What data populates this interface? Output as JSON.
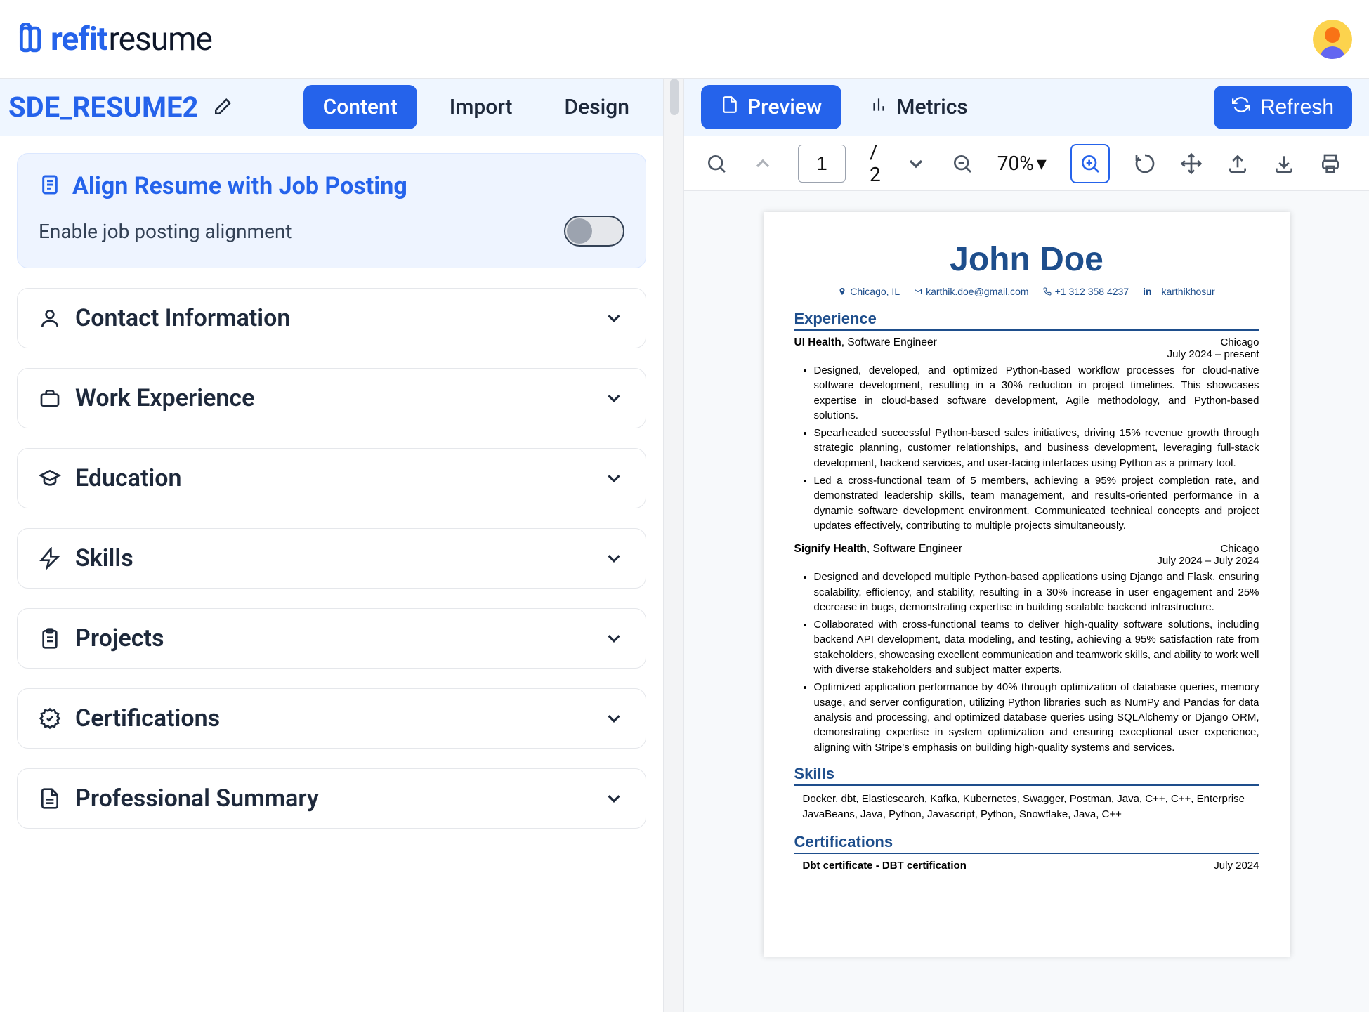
{
  "header": {
    "logo_refit": "refit",
    "logo_resume": "resume"
  },
  "left": {
    "resume_name": "SDE_RESUME2",
    "tabs": {
      "content": "Content",
      "import": "Import",
      "design": "Design"
    },
    "align": {
      "title": "Align Resume with Job Posting",
      "enable_label": "Enable job posting alignment"
    },
    "sections": [
      {
        "id": "contact",
        "label": "Contact Information"
      },
      {
        "id": "work",
        "label": "Work Experience"
      },
      {
        "id": "education",
        "label": "Education"
      },
      {
        "id": "skills",
        "label": "Skills"
      },
      {
        "id": "projects",
        "label": "Projects"
      },
      {
        "id": "certs",
        "label": "Certifications"
      },
      {
        "id": "summary",
        "label": "Professional Summary"
      }
    ]
  },
  "right": {
    "tabs": {
      "preview": "Preview",
      "metrics": "Metrics"
    },
    "refresh": "Refresh",
    "pdf": {
      "page_current": "1",
      "page_total": "2",
      "zoom": "70%"
    }
  },
  "resume": {
    "name": "John Doe",
    "contacts": {
      "location": "Chicago, IL",
      "email": "karthik.doe@gmail.com",
      "phone": "+1 312 358 4237",
      "linkedin": "karthikhosur"
    },
    "experience_heading": "Experience",
    "skills_heading": "Skills",
    "certs_heading": "Certifications",
    "experience": [
      {
        "company": "UI Health",
        "role": "Software Engineer",
        "location": "Chicago",
        "dates": "July 2024 – present",
        "bullets": [
          "Designed, developed, and optimized Python-based workflow processes for cloud-native software development, resulting in a 30% reduction in project timelines. This showcases expertise in cloud-based software development, Agile methodology, and Python-based solutions.",
          "Spearheaded successful Python-based sales initiatives, driving 15% revenue growth through strategic planning, customer relationships, and business development, leveraging full-stack development, backend services, and user-facing interfaces using Python as a primary tool.",
          "Led a cross-functional team of 5 members, achieving a 95% project completion rate, and demonstrated leadership skills, team management, and results-oriented performance in a dynamic software development environment. Communicated technical concepts and project updates effectively, contributing to multiple projects simultaneously."
        ]
      },
      {
        "company": "Signify Health",
        "role": "Software Engineer",
        "location": "Chicago",
        "dates": "July 2024 – July 2024",
        "bullets": [
          "Designed and developed multiple Python-based applications using Django and Flask, ensuring scalability, efficiency, and stability, resulting in a 30% increase in user engagement and 25% decrease in bugs, demonstrating expertise in building scalable backend infrastructure.",
          "Collaborated with cross-functional teams to deliver high-quality software solutions, including backend API development, data modeling, and testing, achieving a 95% satisfaction rate from stakeholders, showcasing excellent communication and teamwork skills, and ability to work well with diverse stakeholders and subject matter experts.",
          "Optimized application performance by 40% through optimization of database queries, memory usage, and server configuration, utilizing Python libraries such as NumPy and Pandas for data analysis and processing, and optimized database queries using SQLAlchemy or Django ORM, demonstrating expertise in system optimization and ensuring exceptional user experience, aligning with Stripe's emphasis on building high-quality systems and services."
        ]
      }
    ],
    "skills_text": "Docker, dbt, Elasticsearch, Kafka, Kubernetes, Swagger, Postman, Java, C++, C++, Enterprise JavaBeans, Java, Python, Javascript, Python, Snowflake, Java, C++",
    "certs": [
      {
        "name": "Dbt certificate - DBT certification",
        "date": "July 2024"
      }
    ]
  }
}
